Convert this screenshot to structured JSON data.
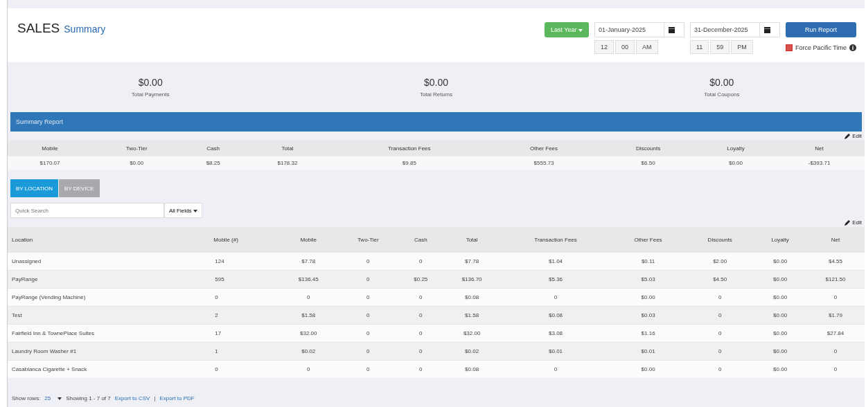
{
  "header": {
    "title": "SALES",
    "subtitle": "Summary"
  },
  "controls": {
    "range_button": "Last Year",
    "start_date": "01-January-2025",
    "end_date": "31-December-2025",
    "start_time": [
      "12",
      "00",
      "AM"
    ],
    "end_time": [
      "11",
      "59",
      "PM"
    ],
    "run_button": "Run Report",
    "force_pacific": {
      "label": "Force Pacific Time",
      "checked": true
    }
  },
  "totals": [
    {
      "amount": "$0.00",
      "label": "Total Payments"
    },
    {
      "amount": "$0.00",
      "label": "Total Returns"
    },
    {
      "amount": "$0.00",
      "label": "Total Coupons"
    }
  ],
  "summary": {
    "title": "Summary Report",
    "edit": "Edit",
    "columns": [
      "Mobile",
      "Two-Tier",
      "Cash",
      "Total",
      "Transaction Fees",
      "Other Fees",
      "Discounts",
      "Loyalty",
      "Net"
    ],
    "row": [
      "$170.07",
      "$0.00",
      "$8.25",
      "$178.32",
      "$9.85",
      "$555.73",
      "$6.50",
      "$0.00",
      "-$393.71"
    ]
  },
  "tabs": [
    {
      "label": "BY LOCATION",
      "selected": true
    },
    {
      "label": "BY DEVICE",
      "selected": false
    }
  ],
  "search": {
    "placeholder": "Quick Search",
    "fields_button": "All Fields"
  },
  "table": {
    "edit": "Edit",
    "columns": [
      "Location",
      "Mobile (#)",
      "Mobile",
      "Two-Tier",
      "Cash",
      "Total",
      "Transaction Fees",
      "Other Fees",
      "Discounts",
      "Loyalty",
      "Net"
    ],
    "rows": [
      [
        "Unassigned",
        "124",
        "$7.78",
        "0",
        "0",
        "$7.78",
        "$1.04",
        "$0.11",
        "$2.00",
        "$0.00",
        "$4.55"
      ],
      [
        "PayRange",
        "595",
        "$136.45",
        "0",
        "$0.25",
        "$136.70",
        "$5.36",
        "$5.03",
        "$4.50",
        "$0.00",
        "$121.50"
      ],
      [
        "PayRange (Vending Machine)",
        "0",
        "0",
        "0",
        "0",
        "$0.08",
        "0",
        "$0.00",
        "0",
        "$0.00",
        "0"
      ],
      [
        "Test",
        "2",
        "$1.58",
        "0",
        "0",
        "$1.58",
        "$0.08",
        "$0.03",
        "0",
        "$0.00",
        "$1.79"
      ],
      [
        "Fairfield Inn & TownePlace Suites",
        "17",
        "$32.00",
        "0",
        "0",
        "$32.00",
        "$3.08",
        "$1.16",
        "0",
        "$0.00",
        "$27.84"
      ],
      [
        "Laundry Room Washer #1",
        "1",
        "$0.02",
        "0",
        "0",
        "$0.02",
        "$0.01",
        "$0.01",
        "0",
        "$0.00",
        "0"
      ],
      [
        "Casablanca Cigarette + Snack",
        "0",
        "0",
        "0",
        "0",
        "$0.08",
        "0",
        "$0.00",
        "0",
        "$0.00",
        "0"
      ]
    ]
  },
  "footer": {
    "show_rows_label": "Show rows:",
    "rows_value": "25",
    "showing": "Showing 1 - 7 of 7",
    "export_csv": "Export to CSV",
    "separator": "|",
    "export_pdf": "Export to PDF"
  }
}
